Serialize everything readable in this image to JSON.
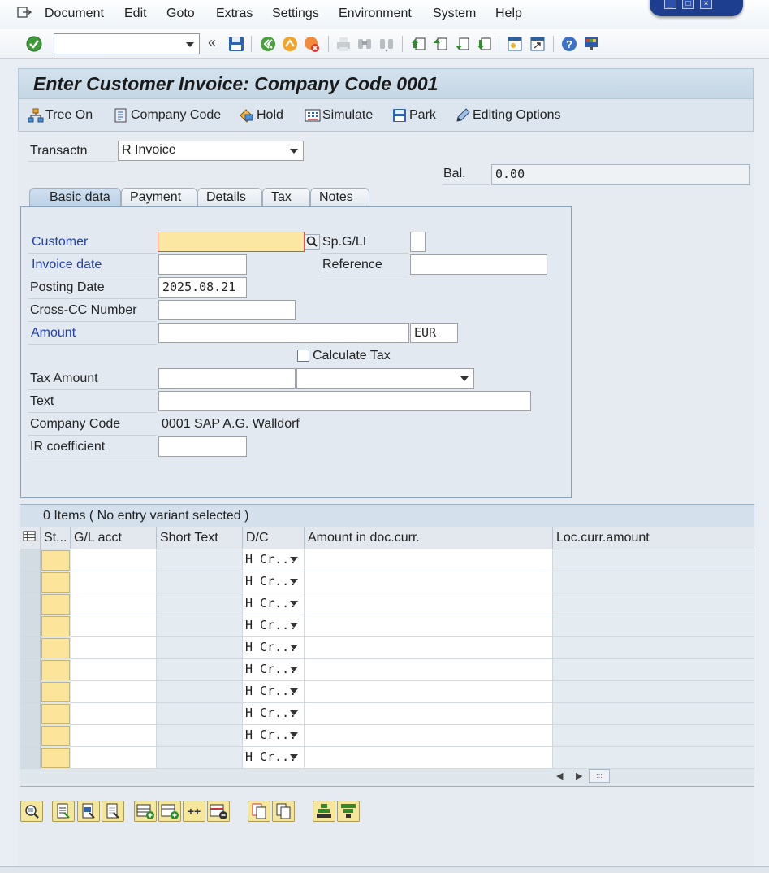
{
  "menubar": {
    "items": [
      {
        "label": "Document"
      },
      {
        "label": "Edit"
      },
      {
        "label": "Goto"
      },
      {
        "label": "Extras"
      },
      {
        "label": "Settings"
      },
      {
        "label": "Environment"
      },
      {
        "label": "System"
      },
      {
        "label": "Help"
      }
    ]
  },
  "systoolbar": {
    "command_field_value": "",
    "icons": [
      "enter-icon",
      "save-icon",
      "back-icon",
      "exit-icon",
      "cancel-icon",
      "print-icon",
      "find-icon",
      "find-next-icon",
      "first-page-icon",
      "previous-page-icon",
      "next-page-icon",
      "last-page-icon",
      "create-session-icon",
      "shortcut-icon",
      "help-icon",
      "customize-layout-icon"
    ]
  },
  "title": "Enter Customer Invoice: Company Code 0001",
  "apptoolbar": {
    "buttons": [
      {
        "label": "Tree On",
        "icon": "tree-icon"
      },
      {
        "label": "Company Code",
        "icon": "company-code-icon"
      },
      {
        "label": "Hold",
        "icon": "hold-icon"
      },
      {
        "label": "Simulate",
        "icon": "simulate-icon"
      },
      {
        "label": "Park",
        "icon": "park-icon"
      },
      {
        "label": "Editing Options",
        "icon": "edit-pencil-icon"
      }
    ]
  },
  "header": {
    "transaction_label": "Transactn",
    "transaction_value": "R Invoice",
    "balance_label": "Bal.",
    "balance_value": "0.00"
  },
  "tabs": [
    {
      "label": "Basic data",
      "active": true
    },
    {
      "label": "Payment",
      "active": false
    },
    {
      "label": "Details",
      "active": false
    },
    {
      "label": "Tax",
      "active": false
    },
    {
      "label": "Notes",
      "active": false
    }
  ],
  "basic_data": {
    "customer_label": "Customer",
    "customer_value": "",
    "spgl_label": "Sp.G/LI",
    "spgl_value": "",
    "invoice_date_label": "Invoice date",
    "invoice_date_value": "",
    "reference_label": "Reference",
    "reference_value": "",
    "posting_date_label": "Posting Date",
    "posting_date_value": "2025.08.21",
    "cross_cc_label": "Cross-CC Number",
    "cross_cc_value": "",
    "amount_label": "Amount",
    "amount_value": "",
    "currency_value": "EUR",
    "calculate_tax_label": "Calculate Tax",
    "calculate_tax_checked": false,
    "tax_amount_label": "Tax Amount",
    "tax_amount_value": "",
    "tax_code_value": "",
    "text_label": "Text",
    "text_value": "",
    "company_code_label": "Company Code",
    "company_code_value": "0001 SAP A.G. Walldorf",
    "ir_coefficient_label": "IR coefficient",
    "ir_coefficient_value": ""
  },
  "items": {
    "title": "0 Items ( No entry variant selected )",
    "columns": [
      "St...",
      "G/L acct",
      "Short Text",
      "D/C",
      "Amount in doc.curr.",
      "Loc.curr.amount"
    ],
    "rows": [
      {
        "dc": "H Cr..."
      },
      {
        "dc": "H Cr..."
      },
      {
        "dc": "H Cr..."
      },
      {
        "dc": "H Cr..."
      },
      {
        "dc": "H Cr..."
      },
      {
        "dc": "H Cr..."
      },
      {
        "dc": "H Cr..."
      },
      {
        "dc": "H Cr..."
      },
      {
        "dc": "H Cr..."
      },
      {
        "dc": "H Cr..."
      }
    ]
  },
  "bottom_toolbar": {
    "icons": [
      "detail-icon",
      "select-all-icon",
      "select-block-icon",
      "deselect-icon",
      "insert-row-icon",
      "add-row-icon",
      "add-multiple-rows-label",
      "delete-row-icon",
      "copy-icon",
      "paste-icon",
      "sort-ascending-icon",
      "filter-icon"
    ],
    "add_multiple_label": "++"
  },
  "colors": {
    "required_label": "#1f3fb3",
    "focus_field": "#fbe7a1",
    "status_cell": "#fae59a",
    "title_bar": "#c5d6e4"
  }
}
